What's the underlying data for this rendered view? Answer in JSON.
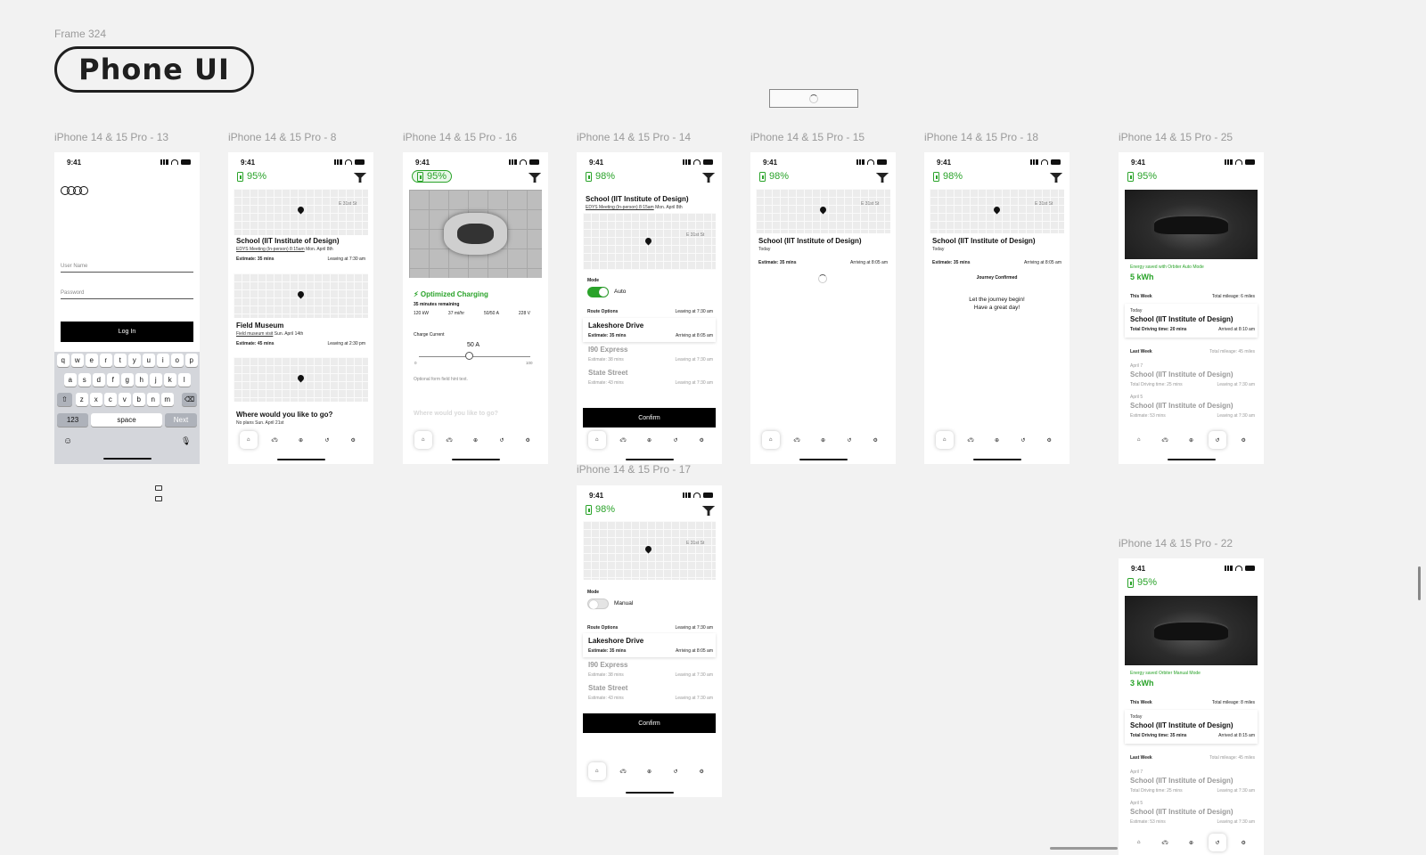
{
  "canvas": {
    "frame_label": "Frame 324",
    "title": "Phone UI"
  },
  "frames": {
    "f13": "iPhone 14 & 15 Pro - 13",
    "f8": "iPhone 14 & 15 Pro - 8",
    "f16": "iPhone 14 & 15 Pro - 16",
    "f14": "iPhone 14 & 15 Pro - 14",
    "f15": "iPhone 14 & 15 Pro - 15",
    "f18": "iPhone 14 & 15 Pro - 18",
    "f25": "iPhone 14 & 15 Pro - 25",
    "f17": "iPhone 14 & 15 Pro - 17",
    "f22": "iPhone 14 & 15 Pro - 22"
  },
  "status": {
    "time": "9:41"
  },
  "battery": {
    "p95": "95%",
    "p98": "98%"
  },
  "login": {
    "username_placeholder": "User Name",
    "password_placeholder": "Password",
    "login_button": "Log In",
    "keys_row1": [
      "q",
      "w",
      "e",
      "r",
      "t",
      "y",
      "u",
      "i",
      "o",
      "p"
    ],
    "keys_row2": [
      "a",
      "s",
      "d",
      "f",
      "g",
      "h",
      "j",
      "k",
      "l"
    ],
    "keys_row3": [
      "z",
      "x",
      "c",
      "v",
      "b",
      "n",
      "m"
    ],
    "key_123": "123",
    "key_space": "space",
    "key_next": "Next"
  },
  "trips": {
    "school_title": "School (IIT Institute of Design)",
    "school_event": "EDYS Meeting (In-person) 8:15am",
    "school_date": "Mon. April 8th",
    "estimate_35": "Estimate: 35 mins",
    "leaving_730": "Leaving at 7:30 am",
    "museum_title": "Field Museum",
    "museum_event": "Field museum visit",
    "museum_date": "Sun. April 14th",
    "estimate_45": "Estimate: 45 mins",
    "leaving_230": "Leaving at 2:30 pm",
    "where_prompt": "Where would you like to go?",
    "no_plans": "No plans Sun. April 21st",
    "today": "Today",
    "arriving_805": "Arriving at 8:05 am",
    "journey_confirmed": "Journey Confirmed",
    "journey_begin": "Let the journey begin!",
    "great_day": "Have a great day!",
    "map_street": "E 31st St"
  },
  "charging": {
    "title": "Optimized Charging",
    "remaining": "35 minutes remaining",
    "stats": [
      "120 kW",
      "37 mi/hr",
      "50/50 A",
      "228 V"
    ],
    "charge_current_label": "Charge Current",
    "current_value": "50 A",
    "slider_min": "0",
    "slider_max": "100",
    "slider_fraction": 0.45,
    "hint": "Optional form field hint text.",
    "where_prompt_faded": "Where would you like to go?"
  },
  "route": {
    "mode_label": "Mode",
    "auto": "Auto",
    "manual": "Manual",
    "route_options": "Route Options",
    "leaving_730": "Leaving at 7:30 am",
    "lakeshore": "Lakeshore Drive",
    "estimate_35": "Estimate: 35 mins",
    "arriving_805": "Arriving at 8:05 am",
    "i90": "I90 Express",
    "estimate_38": "Estimate: 38 mins",
    "state_street": "State Street",
    "estimate_43": "Estimate: 43 mins",
    "confirm": "Confirm"
  },
  "energy": {
    "auto_label": "Energy saved with Orbiter Auto Mode",
    "auto_value": "5 kWh",
    "manual_label": "Energy saved Orbiter Manual Mode",
    "manual_value": "3 kWh",
    "this_week": "This Week",
    "mileage_6": "Total mileage: 6 miles",
    "mileage_8": "Total mileage: 8 miles",
    "today": "Today",
    "school": "School (IIT Institute of Design)",
    "driving_20": "Total Driving time: 20 mins",
    "arrived_810": "Arrived at 8:10 am",
    "driving_35": "Total Driving time: 35 mins",
    "arrived_815": "Arrived at 8:15 am",
    "last_week": "Last Week",
    "mileage_45": "Total mileage: 45 miles",
    "april7": "April 7",
    "driving_25": "Total Driving time: 25 mins",
    "leaving_730": "Leaving at 7:30 am",
    "april5": "April 5",
    "estimate_53": "Estimate: 53 mins"
  },
  "icons": {
    "nav": [
      "home-icon",
      "car-icon",
      "plus-circle-icon",
      "history-icon",
      "gear-icon"
    ]
  }
}
